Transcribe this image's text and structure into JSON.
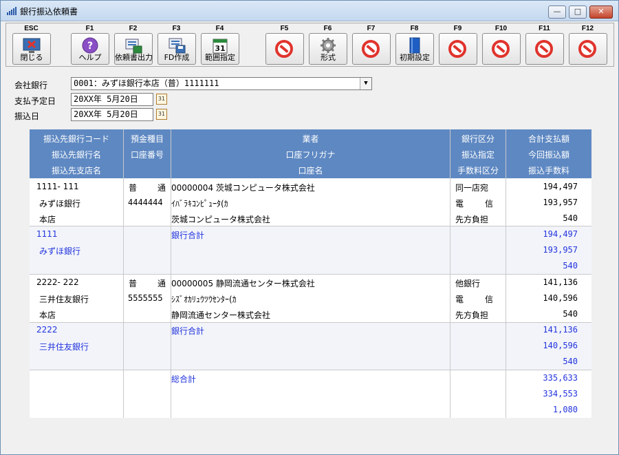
{
  "window": {
    "title": "銀行振込依頼書",
    "min": "—",
    "max": "□",
    "close": "✕"
  },
  "toolbar": [
    {
      "key": "ESC",
      "label": "閉じる",
      "icon": "close-app-icon"
    },
    {
      "key": "F1",
      "label": "ヘルプ",
      "icon": "help-icon"
    },
    {
      "key": "F2",
      "label": "依頼書出力",
      "icon": "print-output-icon"
    },
    {
      "key": "F3",
      "label": "FD作成",
      "icon": "fd-create-icon"
    },
    {
      "key": "F4",
      "label": "範囲指定",
      "icon": "calendar-icon"
    },
    {
      "key": "F5",
      "label": "",
      "icon": "disabled-icon"
    },
    {
      "key": "F6",
      "label": "形式",
      "icon": "gear-icon"
    },
    {
      "key": "F7",
      "label": "",
      "icon": "disabled-icon"
    },
    {
      "key": "F8",
      "label": "初期設定",
      "icon": "book-icon"
    },
    {
      "key": "F9",
      "label": "",
      "icon": "disabled-icon"
    },
    {
      "key": "F10",
      "label": "",
      "icon": "disabled-icon"
    },
    {
      "key": "F11",
      "label": "",
      "icon": "disabled-icon"
    },
    {
      "key": "F12",
      "label": "",
      "icon": "disabled-icon"
    }
  ],
  "form": {
    "bank_label": "会社銀行",
    "bank_value": "0001：みずほ銀行本店（普）1111111",
    "pay_date_label": "支払予定日",
    "pay_date_value": "20XX年 5月20日",
    "transfer_date_label": "振込日",
    "transfer_date_value": "20XX年 5月20日",
    "cal_glyph": "31"
  },
  "table": {
    "headers": {
      "c1": [
        "振込先銀行コード",
        "振込先銀行名",
        "振込先支店名"
      ],
      "c2": [
        "預金種目",
        "口座番号"
      ],
      "c3": [
        "業者",
        "口座フリガナ",
        "口座名"
      ],
      "c4": [
        "銀行区分",
        "振込指定",
        "手数料区分"
      ],
      "c5": [
        "合計支払額",
        "今回振込額",
        "振込手数料"
      ]
    },
    "records": [
      {
        "code": "1111-  111",
        "bank": "みずほ銀行",
        "branch": "本店",
        "type_a": "普",
        "type_b": "通",
        "account": "4444444",
        "vendor": "00000004 茨城コンピュータ株式会社",
        "kana": "ｲﾊﾞﾗｷｺﾝﾋﾟｭｰﾀ(ｶ",
        "acct_name": "茨城コンピュータ株式会社",
        "kubun": "同一店宛",
        "shitei_a": "電",
        "shitei_b": "信",
        "fee_kubun": "先方負担",
        "total": "194,497",
        "current": "193,957",
        "fee": "540",
        "subtotal": {
          "code": "1111",
          "bank": "みずほ銀行",
          "label": "銀行合計",
          "total": "194,497",
          "current": "193,957",
          "fee": "540"
        }
      },
      {
        "code": "2222-  222",
        "bank": "三井住友銀行",
        "branch": "本店",
        "type_a": "普",
        "type_b": "通",
        "account": "5555555",
        "vendor": "00000005 静岡流通センター株式会社",
        "kana": "ｼｽﾞｵｶﾘｭｳﾂｳｾﾝﾀｰ(ｶ",
        "acct_name": "静岡流通センター株式会社",
        "kubun": "他銀行",
        "shitei_a": "電",
        "shitei_b": "信",
        "fee_kubun": "先方負担",
        "total": "141,136",
        "current": "140,596",
        "fee": "540",
        "subtotal": {
          "code": "2222",
          "bank": "三井住友銀行",
          "label": "銀行合計",
          "total": "141,136",
          "current": "140,596",
          "fee": "540"
        }
      }
    ],
    "grand_total": {
      "label": "総合計",
      "total": "335,633",
      "current": "334,553",
      "fee": "1,080"
    }
  }
}
